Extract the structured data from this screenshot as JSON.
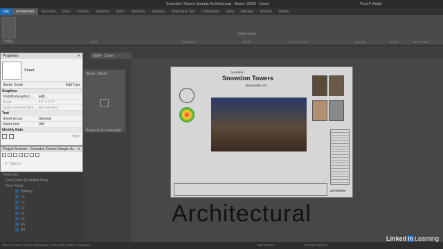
{
  "titlebar": {
    "document": "Snowdon Towers Sample Architectural - Sheet: G000 - Cover",
    "user": "Paul F. Aubin"
  },
  "ribbon_tabs": [
    "File",
    "Architecture",
    "Structure",
    "Steel",
    "Precast",
    "Systems",
    "Insert",
    "Annotate",
    "Analyze",
    "Massing & Site",
    "Collaborate",
    "View",
    "Manage",
    "Add-Ins",
    "Modify"
  ],
  "ribbon_panels": [
    "Select",
    "Build",
    "Circulation",
    "Model",
    "Room & Area",
    "Opening",
    "Datum",
    "Work Plane"
  ],
  "ribbon": {
    "modify_label": "Modify",
    "model_group": "Model Group"
  },
  "properties": {
    "title": "Properties",
    "type_name": "Sheet",
    "instance": "Sheet: Cover",
    "edit_type": "Edit Type",
    "sections": {
      "graphics": "Graphics",
      "text": "Text",
      "identity": "Identity Data"
    },
    "rows": [
      {
        "k": "Visibility/Graphics ...",
        "v": "Edit..."
      },
      {
        "k": "Scale",
        "v": "12\" = 1'-0\""
      },
      {
        "k": "Scale Override (Mul...",
        "v": "As indicated"
      },
      {
        "k": "Sheet Group",
        "v": "General"
      },
      {
        "k": "Sheet Sort",
        "v": "000"
      }
    ],
    "apply": "Apply"
  },
  "project_browser": {
    "title": "Project Browser - Snowdon Towers Sample Ar...",
    "search_placeholder": "Search"
  },
  "tree": [
    "Views (fn)",
    "Floor Plans (Enlarged Plan)",
    "Floor Plans",
    "Parking",
    "L1",
    "L2",
    "L3",
    "L4",
    "L5",
    "R1",
    "R2"
  ],
  "view_tab": "G000 - Cover",
  "sheet_pane": {
    "title": "Sheet : Sheet",
    "help": "Press F1 for more help"
  },
  "sheet": {
    "brand": "Autodesk",
    "project": "Snowdon Towers",
    "location": "Brownsville, PA",
    "footer_brand": "AUTODESK"
  },
  "overlay_word": "Architectural",
  "statusbar": {
    "hint": "Click to select, TAB for alternates, CTRL adds, SHIFT unselects.",
    "model": "Main Model",
    "exclude": "Exclude Options"
  },
  "logo": {
    "linked": "Linked",
    "in": "in",
    "learning": "Learning"
  }
}
